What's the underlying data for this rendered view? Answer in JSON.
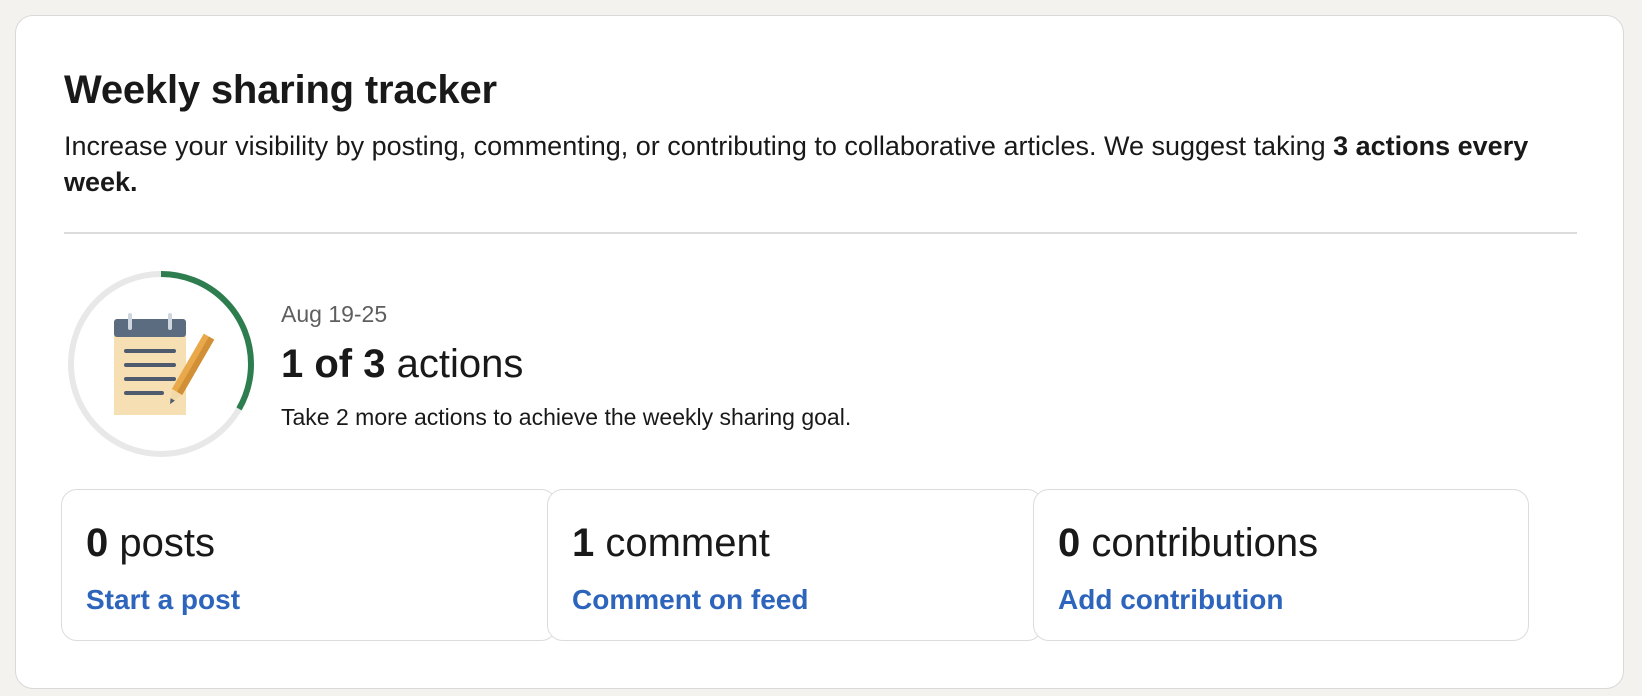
{
  "tracker": {
    "title": "Weekly sharing tracker",
    "description_lead": "Increase your visibility by posting, commenting, or contributing to collaborative articles. We suggest taking ",
    "description_bold": "3 actions every week.",
    "week_range": "Aug 19-25",
    "progress_bold": "1 of 3",
    "progress_suffix": " actions",
    "hint": "Take 2 more actions to achieve the weekly sharing goal.",
    "progress_fraction": 0.333,
    "progress_color": "#2e7d4f",
    "track_color": "#e8e8e8",
    "illustration": "notepad-pencil-icon"
  },
  "stats": [
    {
      "count": "0",
      "label": " posts",
      "link": "Start a post"
    },
    {
      "count": "1",
      "label": " comment",
      "link": "Comment on feed"
    },
    {
      "count": "0",
      "label": " contributions",
      "link": "Add contribution"
    }
  ],
  "colors": {
    "link": "#2d64bc",
    "background": "#f4f2ee",
    "card": "#ffffff"
  }
}
